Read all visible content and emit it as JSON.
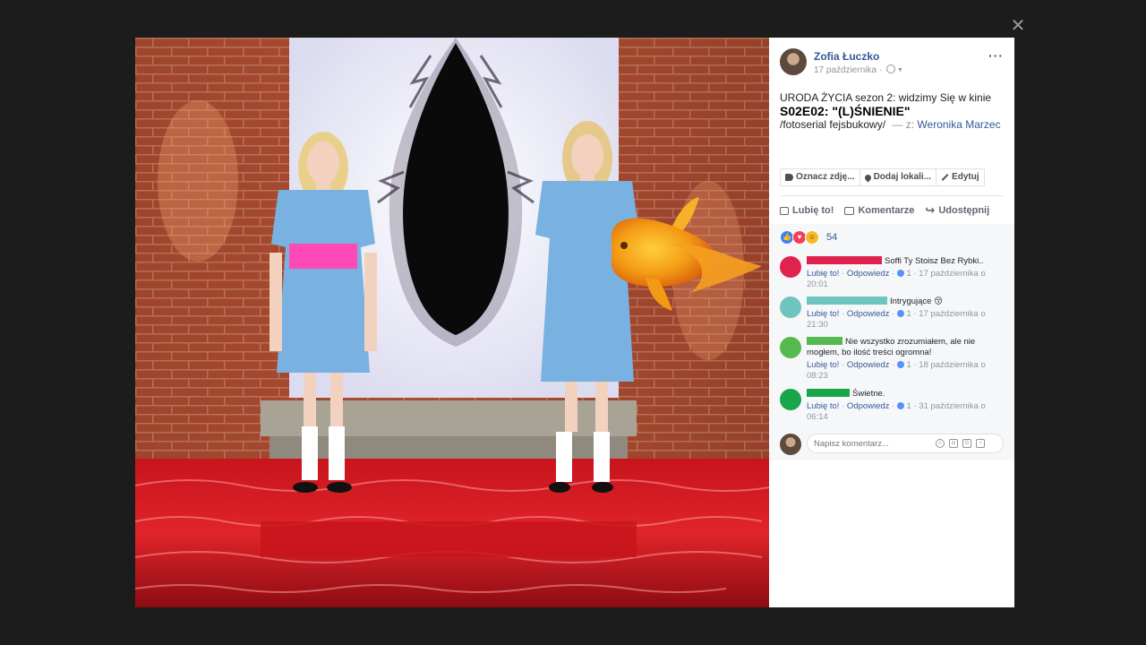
{
  "viewer": {
    "close_icon": "close-icon"
  },
  "post": {
    "author": "Zofia Łuczko",
    "date": "17 października",
    "date_sep": "·",
    "line1": "URODA ŻYCIA sezon 2: widzimy Się w kinie",
    "line2": "S02E02: \"(L)ŚNIENIE\"",
    "line3": "/fotoserial fejsbukowy/",
    "with_label": "— z:",
    "tagged_person": "Weronika Marzec"
  },
  "photo_actions": [
    {
      "label": "Oznacz zdję...",
      "icon": "tag-icon"
    },
    {
      "label": "Dodaj lokali...",
      "icon": "location-pin-icon"
    },
    {
      "label": "Edytuj",
      "icon": "pencil-icon"
    }
  ],
  "actions": {
    "like": "Lubię to!",
    "comment": "Komentarze",
    "share": "Udostępnij"
  },
  "reactions": {
    "count": "54",
    "types": [
      "like",
      "love",
      "haha"
    ]
  },
  "comments": [
    {
      "avatar_color": "#e0234e",
      "redact_color": "#e0234e",
      "redact_width": 84,
      "text": "Soffi Ty Stoisz Bez Rybki..",
      "like": "Lubię to!",
      "sep1": "·",
      "reply": "Odpowiedz",
      "sep2": "·",
      "likes": "1",
      "sep3": "·",
      "time": "17 października o 20:01"
    },
    {
      "avatar_color": "#6ec5bf",
      "redact_color": "#6ec5bf",
      "redact_width": 90,
      "text": "Intrygujące 😚",
      "like": "Lubię to!",
      "sep1": "·",
      "reply": "Odpowiedz",
      "sep2": "·",
      "likes": "1",
      "sep3": "·",
      "time": "17 października o 21:30"
    },
    {
      "avatar_color": "#55b94f",
      "redact_color": "#55b94f",
      "redact_width": 40,
      "text": "Nie wszystko zrozumiałem, ale nie mogłem, bo ilość treści ogromna!",
      "like": "Lubię to!",
      "sep1": "·",
      "reply": "Odpowiedz",
      "sep2": "·",
      "likes": "1",
      "sep3": "·",
      "time": "18 października o 08:23"
    },
    {
      "avatar_color": "#17a64a",
      "redact_color": "#17a64a",
      "redact_width": 48,
      "text": "Świetne.",
      "like": "Lubię to!",
      "sep1": "·",
      "reply": "Odpowiedz",
      "sep2": "·",
      "likes": "1",
      "sep3": "·",
      "time": "31 października o 06:14"
    }
  ],
  "comment_box": {
    "placeholder": "Napisz komentarz...",
    "icons": [
      "emoji-icon",
      "camera-icon",
      "gif-icon",
      "sticker-icon"
    ]
  },
  "colors": {
    "link": "#365899",
    "muted": "#90949c",
    "panel_bg": "#f6f7f9"
  }
}
